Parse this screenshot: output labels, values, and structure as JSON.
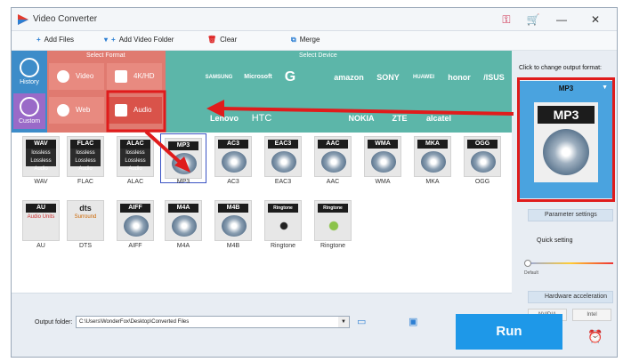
{
  "window": {
    "title": "Video Converter"
  },
  "toolbar": {
    "add_files": "Add Files",
    "add_video_folder": "Add Video Folder",
    "clear": "Clear",
    "merge": "Merge"
  },
  "nav": {
    "history": "History",
    "custom": "Custom"
  },
  "sections": {
    "select_format": "Select Format",
    "select_device": "Select Device"
  },
  "format_categories": [
    {
      "label": "Video"
    },
    {
      "label": "4K/HD"
    },
    {
      "label": "Web"
    },
    {
      "label": "Audio"
    }
  ],
  "devices_row1": [
    "",
    "SAMSUNG",
    "Microsoft",
    "G",
    "",
    "amazon",
    "SONY",
    "HUAWEI",
    "honor",
    "/ISUS"
  ],
  "devices_row2": [
    "",
    "Lenovo",
    "HTC",
    "",
    "",
    "NOKIA",
    "ZTE",
    "alcatel",
    ""
  ],
  "formats_row1": [
    {
      "cap": "WAV",
      "sub": "lossless Lossless Audio",
      "label": "WAV"
    },
    {
      "cap": "FLAC",
      "sub": "lossless Lossless Audio",
      "label": "FLAC"
    },
    {
      "cap": "ALAC",
      "sub": "lossless Lossless Audio",
      "label": "ALAC"
    },
    {
      "cap": "MP3",
      "sub": "",
      "label": "MP3"
    },
    {
      "cap": "AC3",
      "sub": "",
      "label": "AC3"
    },
    {
      "cap": "EAC3",
      "sub": "",
      "label": "EAC3"
    },
    {
      "cap": "AAC",
      "sub": "",
      "label": "AAC"
    },
    {
      "cap": "WMA",
      "sub": "",
      "label": "WMA"
    },
    {
      "cap": "MKA",
      "sub": "",
      "label": "MKA"
    },
    {
      "cap": "OGG",
      "sub": "",
      "label": "OGG"
    }
  ],
  "formats_row2": [
    {
      "cap": "AU",
      "sub": "Audio Units",
      "label": "AU"
    },
    {
      "cap": "dts",
      "sub": "Surround",
      "label": "DTS"
    },
    {
      "cap": "AIFF",
      "sub": "",
      "label": "AIFF"
    },
    {
      "cap": "M4A",
      "sub": "",
      "label": "M4A"
    },
    {
      "cap": "M4B",
      "sub": "",
      "label": "M4B"
    },
    {
      "cap": "Ringtone",
      "sub": "",
      "label": "Ringtone"
    },
    {
      "cap": "Ringtone",
      "sub": "",
      "label": "Ringtone"
    }
  ],
  "right": {
    "click_hint": "Click to change output format:",
    "output_format": "MP3",
    "big_icon_caption": "MP3",
    "parameter_settings": "Parameter settings",
    "quick_setting": "Quick setting",
    "default_label": "Default",
    "hardware_acceleration": "Hardware acceleration",
    "nvidia": "NVIDIA",
    "intel": "Intel"
  },
  "bottom": {
    "output_folder_label": "Output folder:",
    "output_folder_value": "C:\\Users\\WonderFox\\Desktop\\Converted Files",
    "run": "Run"
  },
  "colors": {
    "accent": "#1e98e8",
    "highlight": "#e01c1c",
    "format_bg": "#e07a70",
    "device_bg": "#5cb6a9"
  }
}
